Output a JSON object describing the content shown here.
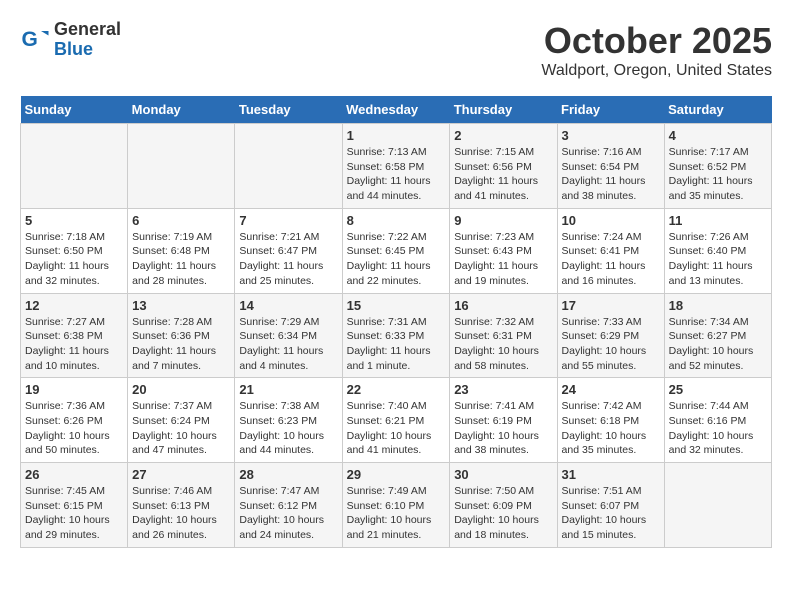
{
  "logo": {
    "general": "General",
    "blue": "Blue"
  },
  "title": "October 2025",
  "location": "Waldport, Oregon, United States",
  "days_of_week": [
    "Sunday",
    "Monday",
    "Tuesday",
    "Wednesday",
    "Thursday",
    "Friday",
    "Saturday"
  ],
  "weeks": [
    [
      {
        "day": "",
        "info": ""
      },
      {
        "day": "",
        "info": ""
      },
      {
        "day": "",
        "info": ""
      },
      {
        "day": "1",
        "info": "Sunrise: 7:13 AM\nSunset: 6:58 PM\nDaylight: 11 hours and 44 minutes."
      },
      {
        "day": "2",
        "info": "Sunrise: 7:15 AM\nSunset: 6:56 PM\nDaylight: 11 hours and 41 minutes."
      },
      {
        "day": "3",
        "info": "Sunrise: 7:16 AM\nSunset: 6:54 PM\nDaylight: 11 hours and 38 minutes."
      },
      {
        "day": "4",
        "info": "Sunrise: 7:17 AM\nSunset: 6:52 PM\nDaylight: 11 hours and 35 minutes."
      }
    ],
    [
      {
        "day": "5",
        "info": "Sunrise: 7:18 AM\nSunset: 6:50 PM\nDaylight: 11 hours and 32 minutes."
      },
      {
        "day": "6",
        "info": "Sunrise: 7:19 AM\nSunset: 6:48 PM\nDaylight: 11 hours and 28 minutes."
      },
      {
        "day": "7",
        "info": "Sunrise: 7:21 AM\nSunset: 6:47 PM\nDaylight: 11 hours and 25 minutes."
      },
      {
        "day": "8",
        "info": "Sunrise: 7:22 AM\nSunset: 6:45 PM\nDaylight: 11 hours and 22 minutes."
      },
      {
        "day": "9",
        "info": "Sunrise: 7:23 AM\nSunset: 6:43 PM\nDaylight: 11 hours and 19 minutes."
      },
      {
        "day": "10",
        "info": "Sunrise: 7:24 AM\nSunset: 6:41 PM\nDaylight: 11 hours and 16 minutes."
      },
      {
        "day": "11",
        "info": "Sunrise: 7:26 AM\nSunset: 6:40 PM\nDaylight: 11 hours and 13 minutes."
      }
    ],
    [
      {
        "day": "12",
        "info": "Sunrise: 7:27 AM\nSunset: 6:38 PM\nDaylight: 11 hours and 10 minutes."
      },
      {
        "day": "13",
        "info": "Sunrise: 7:28 AM\nSunset: 6:36 PM\nDaylight: 11 hours and 7 minutes."
      },
      {
        "day": "14",
        "info": "Sunrise: 7:29 AM\nSunset: 6:34 PM\nDaylight: 11 hours and 4 minutes."
      },
      {
        "day": "15",
        "info": "Sunrise: 7:31 AM\nSunset: 6:33 PM\nDaylight: 11 hours and 1 minute."
      },
      {
        "day": "16",
        "info": "Sunrise: 7:32 AM\nSunset: 6:31 PM\nDaylight: 10 hours and 58 minutes."
      },
      {
        "day": "17",
        "info": "Sunrise: 7:33 AM\nSunset: 6:29 PM\nDaylight: 10 hours and 55 minutes."
      },
      {
        "day": "18",
        "info": "Sunrise: 7:34 AM\nSunset: 6:27 PM\nDaylight: 10 hours and 52 minutes."
      }
    ],
    [
      {
        "day": "19",
        "info": "Sunrise: 7:36 AM\nSunset: 6:26 PM\nDaylight: 10 hours and 50 minutes."
      },
      {
        "day": "20",
        "info": "Sunrise: 7:37 AM\nSunset: 6:24 PM\nDaylight: 10 hours and 47 minutes."
      },
      {
        "day": "21",
        "info": "Sunrise: 7:38 AM\nSunset: 6:23 PM\nDaylight: 10 hours and 44 minutes."
      },
      {
        "day": "22",
        "info": "Sunrise: 7:40 AM\nSunset: 6:21 PM\nDaylight: 10 hours and 41 minutes."
      },
      {
        "day": "23",
        "info": "Sunrise: 7:41 AM\nSunset: 6:19 PM\nDaylight: 10 hours and 38 minutes."
      },
      {
        "day": "24",
        "info": "Sunrise: 7:42 AM\nSunset: 6:18 PM\nDaylight: 10 hours and 35 minutes."
      },
      {
        "day": "25",
        "info": "Sunrise: 7:44 AM\nSunset: 6:16 PM\nDaylight: 10 hours and 32 minutes."
      }
    ],
    [
      {
        "day": "26",
        "info": "Sunrise: 7:45 AM\nSunset: 6:15 PM\nDaylight: 10 hours and 29 minutes."
      },
      {
        "day": "27",
        "info": "Sunrise: 7:46 AM\nSunset: 6:13 PM\nDaylight: 10 hours and 26 minutes."
      },
      {
        "day": "28",
        "info": "Sunrise: 7:47 AM\nSunset: 6:12 PM\nDaylight: 10 hours and 24 minutes."
      },
      {
        "day": "29",
        "info": "Sunrise: 7:49 AM\nSunset: 6:10 PM\nDaylight: 10 hours and 21 minutes."
      },
      {
        "day": "30",
        "info": "Sunrise: 7:50 AM\nSunset: 6:09 PM\nDaylight: 10 hours and 18 minutes."
      },
      {
        "day": "31",
        "info": "Sunrise: 7:51 AM\nSunset: 6:07 PM\nDaylight: 10 hours and 15 minutes."
      },
      {
        "day": "",
        "info": ""
      }
    ]
  ]
}
